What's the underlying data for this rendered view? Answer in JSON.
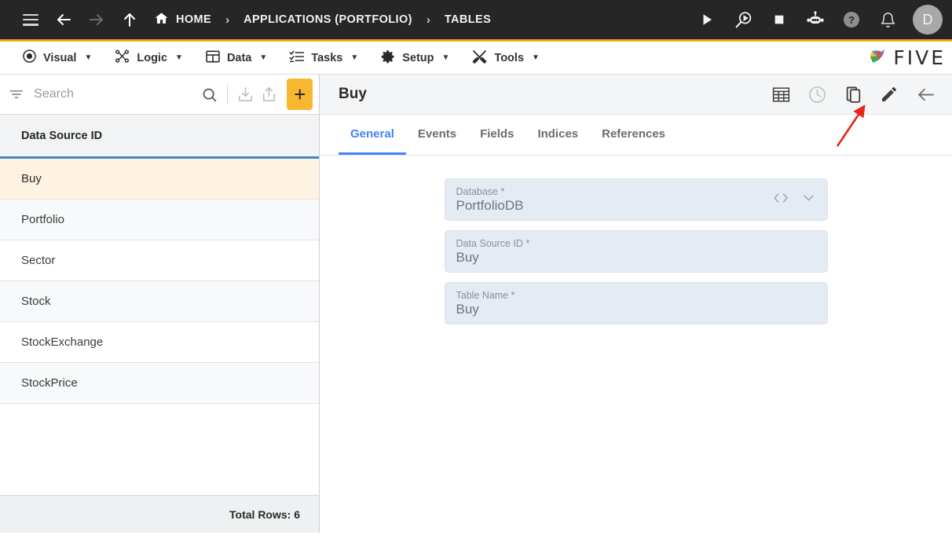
{
  "topbar": {
    "menu_icon": "hamburger-icon",
    "back_icon": "arrow-back-icon",
    "forward_icon": "arrow-forward-icon",
    "up_icon": "arrow-up-icon",
    "breadcrumbs": [
      {
        "label": "HOME",
        "icon": "home-icon"
      },
      {
        "label": "APPLICATIONS (PORTFOLIO)",
        "icon": ""
      },
      {
        "label": "TABLES",
        "icon": ""
      }
    ],
    "separator": "›",
    "actions": [
      {
        "name": "run-icon",
        "glyph": "play"
      },
      {
        "name": "debug-icon",
        "glyph": "search-play"
      },
      {
        "name": "stop-icon",
        "glyph": "stop"
      },
      {
        "name": "bot-icon",
        "glyph": "robot"
      },
      {
        "name": "help-icon",
        "glyph": "question"
      },
      {
        "name": "notifications-icon",
        "glyph": "bell"
      }
    ],
    "avatar_initial": "D"
  },
  "menubar": {
    "accent_color": "#f5ab1e",
    "items": [
      {
        "label": "Visual",
        "icon": "eye-icon"
      },
      {
        "label": "Logic",
        "icon": "flow-icon"
      },
      {
        "label": "Data",
        "icon": "table-icon"
      },
      {
        "label": "Tasks",
        "icon": "checklist-icon"
      },
      {
        "label": "Setup",
        "icon": "gear-icon"
      },
      {
        "label": "Tools",
        "icon": "tools-icon"
      }
    ],
    "caret": "▼",
    "brand": {
      "text": "FIVE",
      "logo": "five-pinwheel-logo"
    }
  },
  "sidebar": {
    "search": {
      "placeholder": "Search",
      "value": ""
    },
    "filter_icon": "filter-icon",
    "search_icon": "search-icon",
    "import_icon": "import-icon",
    "export_icon": "export-icon",
    "add_label": "+",
    "column_header": "Data Source ID",
    "rows": [
      {
        "label": "Buy",
        "selected": true
      },
      {
        "label": "Portfolio",
        "selected": false
      },
      {
        "label": "Sector",
        "selected": false
      },
      {
        "label": "Stock",
        "selected": false
      },
      {
        "label": "StockExchange",
        "selected": false
      },
      {
        "label": "StockPrice",
        "selected": false
      }
    ],
    "footer": "Total Rows: 6",
    "selected_color": "#fdf3e0",
    "header_underline_color": "#4285c5"
  },
  "content": {
    "title": "Buy",
    "header_icons": [
      {
        "name": "table-view-icon",
        "state": "enabled"
      },
      {
        "name": "history-clock-icon",
        "state": "disabled"
      },
      {
        "name": "duplicate-copy-icon",
        "state": "enabled"
      },
      {
        "name": "edit-pencil-icon",
        "state": "enabled"
      },
      {
        "name": "back-arrow-icon",
        "state": "enabled"
      }
    ],
    "tabs": [
      {
        "label": "General",
        "active": true
      },
      {
        "label": "Events",
        "active": false
      },
      {
        "label": "Fields",
        "active": false
      },
      {
        "label": "Indices",
        "active": false
      },
      {
        "label": "References",
        "active": false
      }
    ],
    "active_tab_color": "#4285f4",
    "fields": [
      {
        "label": "Database *",
        "value": "PortfolioDB",
        "has_code_icon": true,
        "has_dropdown": true
      },
      {
        "label": "Data Source ID *",
        "value": "Buy",
        "has_code_icon": false,
        "has_dropdown": false
      },
      {
        "label": "Table Name *",
        "value": "Buy",
        "has_code_icon": false,
        "has_dropdown": false
      }
    ]
  },
  "annotation": {
    "name": "red-arrow-annotation",
    "color": "#e8231b",
    "points_to": "duplicate-copy-icon"
  }
}
